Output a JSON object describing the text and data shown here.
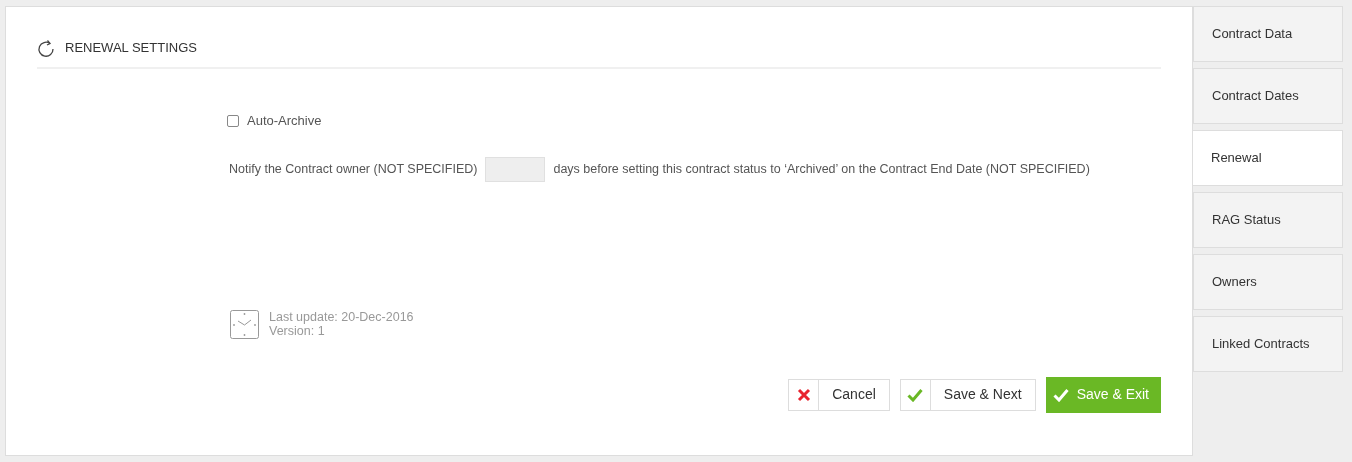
{
  "section": {
    "title": "RENEWAL SETTINGS"
  },
  "auto_archive": {
    "label": "Auto-Archive",
    "checked": false
  },
  "notify": {
    "before": "Notify the Contract owner (NOT SPECIFIED)",
    "after": "days before setting this contract status to ‘Archived’ on the Contract End Date (NOT SPECIFIED)"
  },
  "meta": {
    "last_update": "Last update: 20-Dec-2016",
    "version": "Version: 1"
  },
  "buttons": [
    {
      "label": "Cancel",
      "kind": "cancel"
    },
    {
      "label": "Save & Next",
      "kind": "next"
    },
    {
      "label": "Save & Exit",
      "kind": "primary"
    }
  ],
  "tabs": [
    {
      "label": "Contract Data",
      "selected": false
    },
    {
      "label": "Contract Dates",
      "selected": false
    },
    {
      "label": "Renewal",
      "selected": true
    },
    {
      "label": "RAG Status",
      "selected": false
    },
    {
      "label": "Owners",
      "selected": false
    },
    {
      "label": "Linked Contracts",
      "selected": false
    }
  ]
}
